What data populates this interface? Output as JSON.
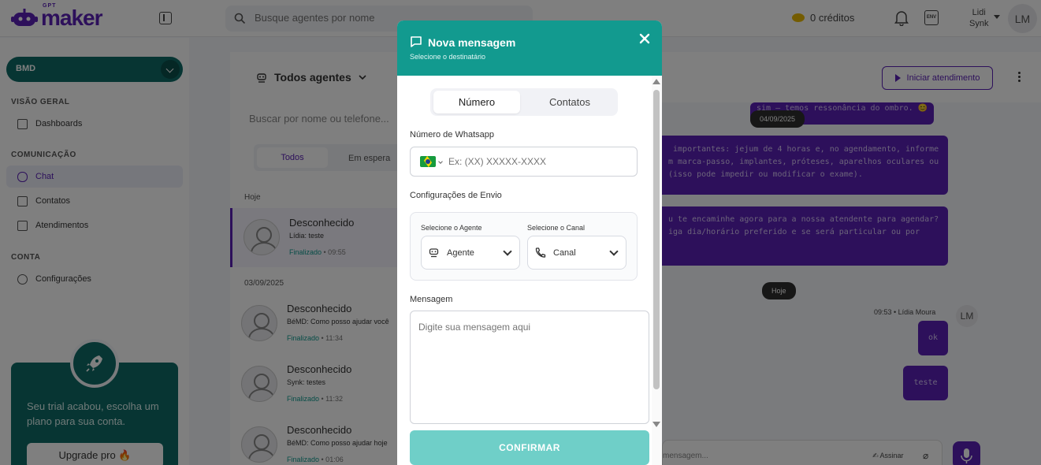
{
  "brand": {
    "small": "GPT",
    "name": "maker",
    "color": "#5b21b6"
  },
  "topbar": {
    "search_placeholder": "Busque agentes por nome",
    "credits": "0 créditos",
    "env_label": "ENV",
    "user_first": "Lidi",
    "user_org": "Synk",
    "user_initials": "LM"
  },
  "sidebar": {
    "workspace": "BMD",
    "sections": {
      "overview": "VISÃO GERAL",
      "communication": "COMUNICAÇÃO",
      "account": "CONTA"
    },
    "items": {
      "dashboards": "Dashboards",
      "chat": "Chat",
      "contacts": "Contatos",
      "tickets": "Atendimentos",
      "settings": "Configurações"
    },
    "promo": {
      "text": "Seu trial acabou, escolha um plano para sua conta.",
      "button": "Upgrade pro 🔥"
    }
  },
  "list": {
    "agents_filter": "Todos agentes",
    "search_placeholder": "Buscar por nome ou telefone...",
    "tabs": {
      "all": "Todos",
      "waiting": "Em espera"
    },
    "groups": [
      {
        "date": "Hoje"
      },
      {
        "date": "03/09/2025"
      }
    ],
    "conversations": [
      {
        "name": "Desconhecido",
        "sender": "Lídia:",
        "preview": " teste",
        "status": "Finalizado",
        "time": " • 09:55"
      },
      {
        "name": "Desconhecido",
        "sender": "BéMD:",
        "preview": " Como posso ajudar você",
        "status": "Finalizado",
        "time": " • 11:34"
      },
      {
        "name": "Desconhecido",
        "sender": "Synk:",
        "preview": " testes",
        "status": "Finalizado",
        "time": " • 11:32"
      },
      {
        "name": "Desconhecido",
        "sender": "BéMD:",
        "preview": " Como posso ajudar hoje",
        "status": "Finalizado",
        "time": " • 01:06"
      }
    ]
  },
  "chat": {
    "start_button": "Iniciar atendimento",
    "bubbles": [
      "sim — temos ressonância do ombro. 😊",
      " importantes: jejum de 4 horas e, no agendamento, informe\nm marca-passo, implantes, próteses, aparelhos oculares ou\n(isso pode impedir ou modificar o exame).",
      "u te encaminhe agora para a nossa atendente para agendar?\niga dia/horário preferido e se será particular ou por"
    ],
    "date_pill_1": "04/09/2025",
    "date_pill_2": "Hoje",
    "msg_meta": "09:53 • Lídia Moura",
    "msg_initials": "LM",
    "msg_1": "ok",
    "msg_2": "teste",
    "composer_placeholder": "mensagem...",
    "sign_label": "Assinar"
  },
  "modal": {
    "title": "Nova mensagem",
    "subtitle": "Selecione o destinatário",
    "tabs": {
      "number": "Número",
      "contacts": "Contatos"
    },
    "whatsapp_label": "Número de Whatsapp",
    "phone_placeholder": "Ex: (XX) XXXXX-XXXX",
    "send_config_label": "Configurações de Envio",
    "agent_label": "Selecione o Agente",
    "agent_value": "Agente",
    "channel_label": "Selecione o Canal",
    "channel_value": "Canal",
    "message_label": "Mensagem",
    "message_placeholder": "Digite sua mensagem aqui",
    "confirm": "CONFIRMAR"
  },
  "colors": {
    "teal_header": "#129a8f",
    "confirm_button": "#6fcfc8",
    "purple": "#5b21b6",
    "workspace": "#0e6b66"
  }
}
